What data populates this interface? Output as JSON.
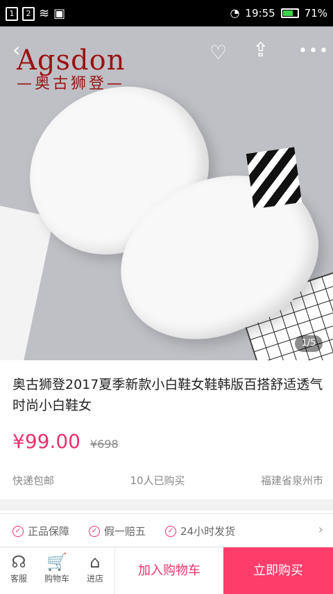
{
  "status_bar": {
    "sim1": "1",
    "sim2": "2",
    "time": "19:55",
    "battery": "71%",
    "battery_level": 0.71
  },
  "hero": {
    "brand_en": "Agsdon",
    "brand_cn": "—奥古狮登—",
    "image_index": "1/5"
  },
  "product": {
    "title": "奥古狮登2017夏季新款小白鞋女鞋韩版百搭舒适透气时尚小白鞋女",
    "price": "¥99.00",
    "original_price": "¥698",
    "shipping": "快递包邮",
    "sold": "10人已购买",
    "location": "福建省泉州市"
  },
  "guarantees": [
    "正品保障",
    "假一赔五",
    "24小时发货"
  ],
  "bottom_bar": {
    "service": "客服",
    "cart": "购物车",
    "store": "进店",
    "add_to_cart": "加入购物车",
    "buy_now": "立即购买"
  },
  "colors": {
    "accent": "#e8336a",
    "buy_button": "#ff3d6b",
    "brand": "#9a1313"
  }
}
